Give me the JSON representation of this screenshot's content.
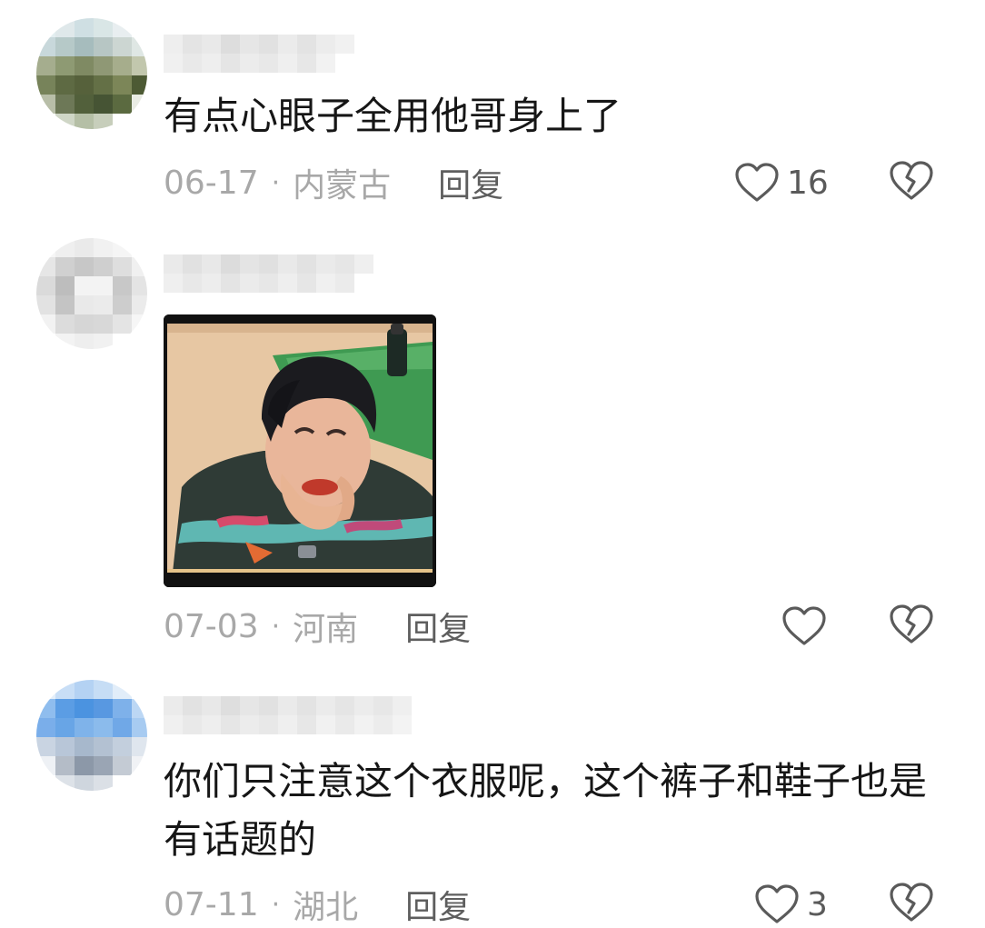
{
  "comments": [
    {
      "text": "有点心眼子全用他哥身上了",
      "date": "06-17",
      "separator": "·",
      "location": "内蒙古",
      "reply_label": "回复",
      "like_count": "16"
    },
    {
      "text": "",
      "date": "07-03",
      "separator": "·",
      "location": "河南",
      "reply_label": "回复",
      "like_count": ""
    },
    {
      "text": "你们只注意这个衣服呢，这个裤子和鞋子也是有话题的",
      "date": "07-11",
      "separator": "·",
      "location": "湖北",
      "reply_label": "回复",
      "like_count": "3"
    }
  ],
  "colors": {
    "text": "#161616",
    "meta": "#a8a8a8",
    "reply": "#5e5e5e",
    "icon": "#5a5a5a"
  },
  "icons": {
    "like": "heart-outline-icon",
    "dislike": "broken-heart-icon"
  }
}
